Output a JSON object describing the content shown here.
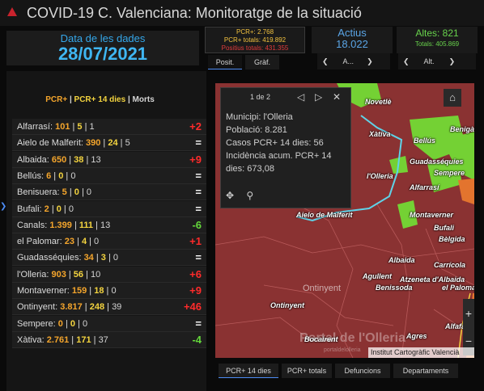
{
  "app": {
    "title": "COVID-19 C. Valenciana: Monitoratge de la situació",
    "accent_color": "#4d8cf5"
  },
  "indicators": {
    "date_label": "Data de les dades",
    "date_value": "28/07/2021",
    "pcr_line1": "PCR+: 2.768",
    "pcr_line2": "PCR+ totals: 419.892",
    "pcr_line3": "Positius totals: 431.355",
    "tab_posit": "Posit.",
    "tab_graf": "Gràf.",
    "actius_label": "Actius",
    "actius_value": "18.022",
    "actius_nav": "A...",
    "altes_label": "Altes: 821",
    "altes_total": "Totals: 405.869",
    "altes_nav": "Alt."
  },
  "list": {
    "header_pcr": "PCR+",
    "header_sep1": " | ",
    "header_pcr14": "PCR+ 14 dies",
    "header_sep2": " | ",
    "header_morts": "Morts",
    "rows": [
      {
        "name": "Alfarrasí:",
        "pcr": "101",
        "p14": "5",
        "morts": "1",
        "change": "+2",
        "dir": "up"
      },
      {
        "name": "Aielo de Malferit:",
        "pcr": "390",
        "p14": "24",
        "morts": "5",
        "change": "=",
        "dir": "eq"
      },
      {
        "name": "Albaida:",
        "pcr": "650",
        "p14": "38",
        "morts": "13",
        "change": "+9",
        "dir": "up"
      },
      {
        "name": "Bellús:",
        "pcr": "6",
        "p14": "0",
        "morts": "0",
        "change": "=",
        "dir": "eq"
      },
      {
        "name": "Benisuera:",
        "pcr": "5",
        "p14": "0",
        "morts": "0",
        "change": "=",
        "dir": "eq"
      },
      {
        "name": "Bufali:",
        "pcr": "2",
        "p14": "0",
        "morts": "0",
        "change": "=",
        "dir": "eq"
      },
      {
        "name": "Canals:",
        "pcr": "1.399",
        "p14": "111",
        "morts": "13",
        "change": "-6",
        "dir": "down"
      },
      {
        "name": "el Palomar:",
        "pcr": "23",
        "p14": "4",
        "morts": "0",
        "change": "+1",
        "dir": "up"
      },
      {
        "name": "Guadasséquies:",
        "pcr": "34",
        "p14": "3",
        "morts": "0",
        "change": "=",
        "dir": "eq"
      },
      {
        "name": "l'Olleria:",
        "pcr": "903",
        "p14": "56",
        "morts": "10",
        "change": "+6",
        "dir": "up"
      },
      {
        "name": "Montaverner:",
        "pcr": "159",
        "p14": "18",
        "morts": "0",
        "change": "+9",
        "dir": "up"
      },
      {
        "name": "Ontinyent:",
        "pcr": "3.817",
        "p14": "248",
        "morts": "39",
        "change": "+46",
        "dir": "up"
      },
      {
        "name": "Sempere:",
        "pcr": "0",
        "p14": "0",
        "morts": "0",
        "change": "=",
        "dir": "eq"
      },
      {
        "name": "Xàtiva:",
        "pcr": "2.761",
        "p14": "171",
        "morts": "37",
        "change": "-4",
        "dir": "down"
      }
    ]
  },
  "popup": {
    "pager": "1 de 2",
    "line1": "Municipi: l'Olleria",
    "line2": "Població: 8.281",
    "line3": "Casos PCR+ 14 dies: 56",
    "line4": "Incidència acum. PCR+ 14",
    "line5": "dies: 673,08"
  },
  "map": {
    "labels": [
      {
        "text": "Novetlè"
      },
      {
        "text": "Xàtiva"
      },
      {
        "text": "Benigà"
      },
      {
        "text": "Bellús"
      },
      {
        "text": "Guadasséquies"
      },
      {
        "text": "Sempere"
      },
      {
        "text": "l'Olleria"
      },
      {
        "text": "Alfarrasí"
      },
      {
        "text": "Aielo de Malferit"
      },
      {
        "text": "Montaverner"
      },
      {
        "text": "Bufali"
      },
      {
        "text": "Bèlgida"
      },
      {
        "text": "Albaida"
      },
      {
        "text": "Carrícola"
      },
      {
        "text": "Agullent"
      },
      {
        "text": "Atzeneta d'Albaida"
      },
      {
        "text": "Benissoda"
      },
      {
        "text": "el Palomar"
      },
      {
        "text": "Ontinyent"
      },
      {
        "text": "Ontinyent"
      },
      {
        "text": "Agres"
      },
      {
        "text": "Bocairent"
      },
      {
        "text": "Alfafara"
      }
    ],
    "attribution": "Institut Cartogràfic Valencià",
    "watermark": "Portal de l'Olleria",
    "watermark_sub": "portaldelolleria",
    "colors": {
      "red": "#8a3232",
      "green": "#74d134",
      "orange": "#e3742e",
      "cyan": "#5fd3e8"
    }
  },
  "bottom_tabs": [
    "PCR+ 14 dies",
    "PCR+ totals",
    "Defuncions",
    "Departaments"
  ]
}
